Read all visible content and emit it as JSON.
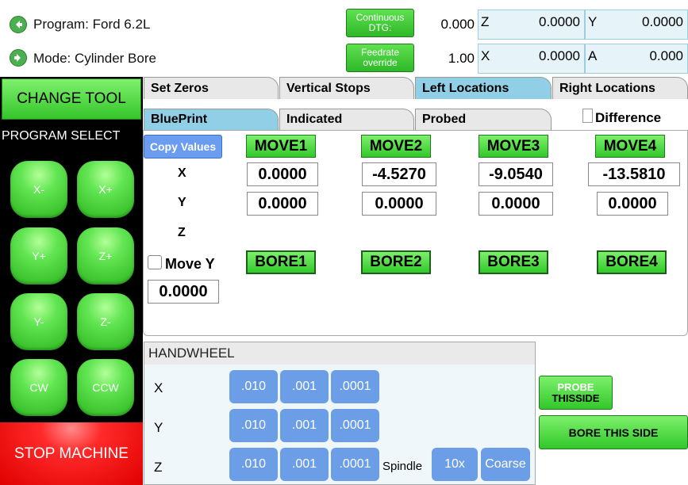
{
  "top": {
    "program": "Program: Ford 6.2L",
    "mode": "Mode: Cylinder Bore",
    "continuous_btn": [
      "Continuous",
      "DTG:"
    ],
    "feedrate_btn": [
      "Feedrate",
      "override"
    ],
    "dtg_value": "0.000",
    "feedrate_value": "1.00",
    "axes": [
      {
        "label": "Z",
        "value": "0.0000"
      },
      {
        "label": "Y",
        "value": "0.0000"
      },
      {
        "label": "X",
        "value": "0.0000"
      },
      {
        "label": "A",
        "value": "0.000"
      }
    ]
  },
  "left": {
    "change_tool": "CHANGE TOOL",
    "program_select": "PROGRAM SELECT",
    "jog": [
      "X-",
      "X+",
      "Y+",
      "Z+",
      "Y-",
      "Z-",
      "CW",
      "CCW"
    ],
    "stop": "STOP MACHINE"
  },
  "tabs_top": [
    "Set Zeros",
    "Vertical Stops",
    "Left Locations",
    "Right Locations"
  ],
  "tabs_sub": [
    "BluePrint",
    "Indicated",
    "Probed"
  ],
  "difference_label": "Difference",
  "grid": {
    "copy_values": "Copy Values",
    "moves": [
      "MOVE1",
      "MOVE2",
      "MOVE3",
      "MOVE4"
    ],
    "rows": [
      "X",
      "Y",
      "Z"
    ],
    "x_values": [
      "0.0000",
      "-4.5270",
      "-9.0540",
      "-13.5810"
    ],
    "y_values": [
      "0.0000",
      "0.0000",
      "0.0000",
      "0.0000"
    ],
    "move_y_label": "Move Y",
    "move_y_value": "0.0000",
    "bores": [
      "BORE1",
      "BORE2",
      "BORE3",
      "BORE4"
    ]
  },
  "handwheel": {
    "title": "HANDWHEEL",
    "axes": [
      "X",
      "Y",
      "Z"
    ],
    "steps": [
      ".010",
      ".001",
      ".0001"
    ],
    "spindle_label": "Spindle",
    "spindle_buttons": [
      "10x",
      "Coarse"
    ]
  },
  "side": {
    "probe": [
      "PROBE",
      "THISSIDE"
    ],
    "bore_this_side": "BORE THIS SIDE"
  }
}
